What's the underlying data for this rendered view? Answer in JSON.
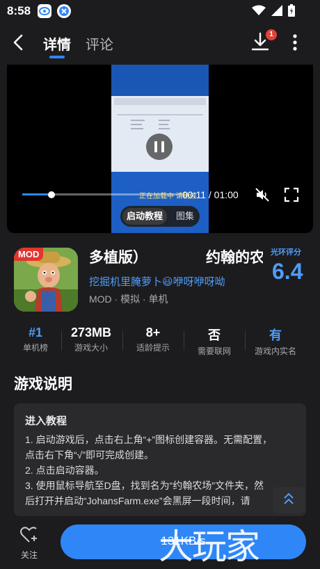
{
  "status_bar": {
    "time": "8:58"
  },
  "nav": {
    "tab_details": "详情",
    "tab_comments": "评论",
    "download_badge": "1"
  },
  "video": {
    "current_time": "00:11",
    "total_time": "/ 01:00",
    "time_display": "00:11 / 01:00",
    "progress": 0.183,
    "tab_tutorial": "启动教程",
    "tab_gallery": "图集",
    "overlay_text": "正在加载中 请稍候"
  },
  "game": {
    "mod_tag": "MOD",
    "title_part_1": "多植版）",
    "title_part_2": "约翰的农",
    "developer": "挖掘机里腌萝卜😃咿呀咿呀呦",
    "genre": "MOD · 模拟 · 单机",
    "rating_label": "光环评分",
    "rating_score": "6.4"
  },
  "stats": [
    {
      "value": "#1",
      "label": "单机榜",
      "accent": true
    },
    {
      "value": "273MB",
      "label": "游戏大小",
      "accent": false
    },
    {
      "value": "8+",
      "label": "适龄提示",
      "accent": false
    },
    {
      "value": "否",
      "label": "需要联网",
      "accent": false
    },
    {
      "value": "有",
      "label": "游戏内实名",
      "accent": true
    }
  ],
  "description": {
    "section_title": "游戏说明",
    "heading": "进入教程",
    "lines": [
      "1. 启动游戏后，点击右上角“+”图标创建容器。无需配置，",
      "点击右下角“√”即可完成创建。",
      "2. 点击启动容器。",
      "3. 使用鼠标导航至D盘，找到名为“约翰农场”文件夹，然",
      "后打开并启动“JohansFarm.exe”会黑屏一段时间，请"
    ]
  },
  "bottom": {
    "follow_label": "关注",
    "download_speed": "131KB/s",
    "watermark": "大玩家"
  },
  "colors": {
    "accent": "#2f86f6",
    "background": "#1c1c1e",
    "card": "#2a2a2c",
    "badge_red": "#e0433a",
    "mod_red": "#e3342f"
  }
}
